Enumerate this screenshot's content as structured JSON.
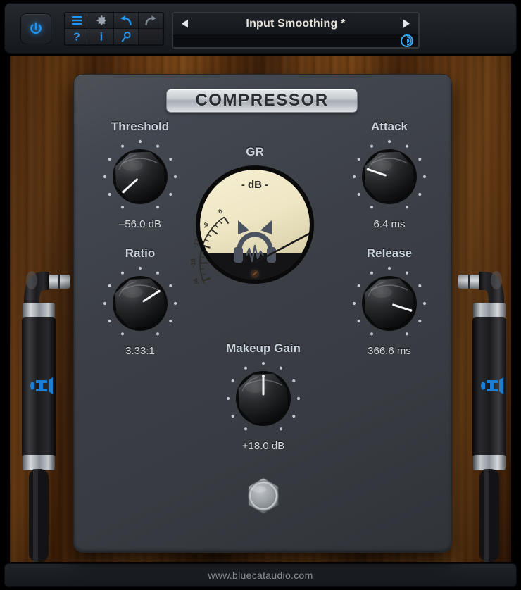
{
  "toolbar": {
    "power": {
      "name": "power-button",
      "title": "Bypass / Power"
    },
    "buttons": [
      {
        "icon": "menu-icon",
        "label": "Menu"
      },
      {
        "icon": "gear-icon",
        "label": "Settings"
      },
      {
        "icon": "undo-icon",
        "label": "Undo"
      },
      {
        "icon": "redo-icon",
        "label": "Redo"
      },
      {
        "icon": "help-icon",
        "label": "?"
      },
      {
        "icon": "info-icon",
        "label": "i"
      },
      {
        "icon": "search-icon",
        "label": "Search"
      },
      {
        "icon": "blank-icon",
        "label": ""
      }
    ]
  },
  "preset": {
    "name": "Input Smoothing *",
    "prev_label": "◀",
    "next_label": "▶",
    "brand_icon": "bluecat-logo-icon"
  },
  "panel": {
    "title": "COMPRESSOR"
  },
  "meter": {
    "label": "GR",
    "scale_title": "- dB -",
    "ticks": [
      "-30",
      "-24",
      "-18",
      "-12",
      "-6",
      "0"
    ],
    "needle_value": 0,
    "needle_angle_deg": 62,
    "face_color": "#eee6c4",
    "logo_icon": "bluecat-headphones-icon"
  },
  "knobs": [
    {
      "name": "threshold",
      "label": "Threshold",
      "value": "–56.0 dB",
      "angle": -132
    },
    {
      "name": "attack",
      "label": "Attack",
      "value": "6.4 ms",
      "angle": -71
    },
    {
      "name": "ratio",
      "label": "Ratio",
      "value": "3.33:1",
      "angle": 57
    },
    {
      "name": "release",
      "label": "Release",
      "value": "366.6 ms",
      "angle": 108
    },
    {
      "name": "makeup",
      "label": "Makeup Gain",
      "value": "+18.0 dB",
      "angle": 0
    }
  ],
  "footswitch": {
    "name": "bypass-footswitch",
    "state": "engaged"
  },
  "footer": {
    "url": "www.bluecataudio.com"
  },
  "colors": {
    "accent_blue": "#2196f3",
    "panel_gray": "#3c4046",
    "meter_cream": "#eee6c4",
    "wood_brown": "#8d4a13",
    "label_text": "#cbd4dd"
  }
}
